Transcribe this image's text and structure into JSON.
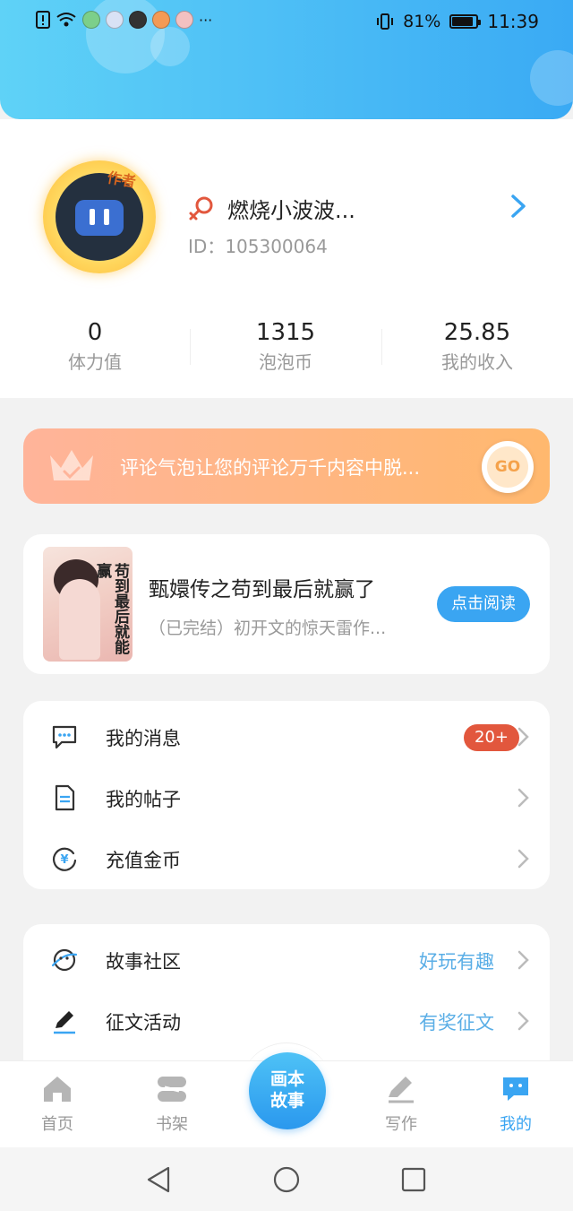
{
  "status_bar": {
    "battery_percent": "81%",
    "battery_level": 0.81,
    "time": "11:39",
    "more_indicator": "···",
    "icons": [
      "alert-icon",
      "wifi-icon",
      "app-notification-icon",
      "music-notification-icon",
      "app-notification-icon",
      "app-notification-icon",
      "app-notification-icon"
    ]
  },
  "profile": {
    "avatar_tag": "作者",
    "nickname": "燃烧小波波...",
    "id_label": "ID：",
    "id_value": "105300064",
    "gender_color": "#e2573d"
  },
  "stats": [
    {
      "value": "0",
      "label": "体力值"
    },
    {
      "value": "1315",
      "label": "泡泡币"
    },
    {
      "value": "25.85",
      "label": "我的收入"
    }
  ],
  "banner": {
    "text": "评论气泡让您的评论万千内容中脱...",
    "button": "GO"
  },
  "book": {
    "cover_title": "苟到最后就能赢",
    "title": "甄嬛传之苟到最后就赢了",
    "description": "（已完结）初开文的惊天雷作...",
    "read_button": "点击阅读"
  },
  "menu_primary": [
    {
      "icon": "message-icon",
      "label": "我的消息",
      "badge": "20+"
    },
    {
      "icon": "document-icon",
      "label": "我的帖子"
    },
    {
      "icon": "coin-icon",
      "label": "充值金币"
    }
  ],
  "menu_secondary": [
    {
      "icon": "planet-icon",
      "label": "故事社区",
      "hint": "好玩有趣"
    },
    {
      "icon": "pen-icon",
      "label": "征文活动",
      "hint": "有奖征文"
    }
  ],
  "tabbar": {
    "tabs": [
      {
        "label": "首页",
        "icon": "home-icon"
      },
      {
        "label": "书架",
        "icon": "bookshelf-icon"
      },
      {
        "label": "写作",
        "icon": "write-icon"
      },
      {
        "label": "我的",
        "icon": "profile-bubble-icon",
        "active": true
      }
    ],
    "center_line1": "画本",
    "center_line2": "故事"
  },
  "colors": {
    "header_gradient_start": "#5fd2f7",
    "header_gradient_end": "#3aaaf4",
    "accent": "#3aa5f2",
    "badge": "#e2573d",
    "banner_start": "#ffb49a",
    "banner_end": "#ffb86e"
  }
}
